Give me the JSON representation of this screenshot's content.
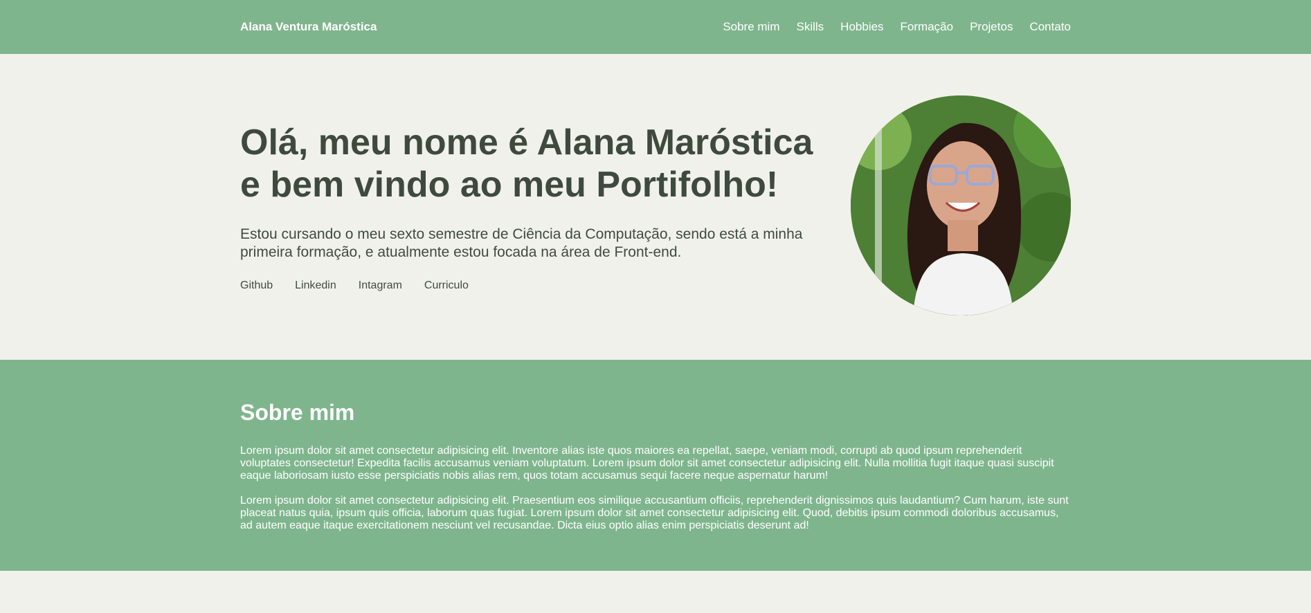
{
  "header": {
    "brand": "Alana Ventura Maróstica",
    "nav": [
      "Sobre mim",
      "Skills",
      "Hobbies",
      "Formação",
      "Projetos",
      "Contato"
    ]
  },
  "hero": {
    "title_line1": "Olá, meu nome é Alana Maróstica",
    "title_line2": "e bem vindo ao meu Portifolho!",
    "subtitle": "Estou cursando o meu sexto semestre de Ciência da Computação, sendo está a minha primeira formação, e atualmente estou focada na área de Front-end.",
    "links": [
      "Github",
      "Linkedin",
      "Intagram",
      "Curriculo"
    ]
  },
  "about": {
    "title": "Sobre mim",
    "paragraphs": [
      "Lorem ipsum dolor sit amet consectetur adipisicing elit. Inventore alias iste quos maiores ea repellat, saepe, veniam modi, corrupti ab quod ipsum reprehenderit voluptates consectetur! Expedita facilis accusamus veniam voluptatum. Lorem ipsum dolor sit amet consectetur adipisicing elit. Nulla mollitia fugit itaque quasi suscipit eaque laboriosam iusto esse perspiciatis nobis alias rem, quos totam accusamus sequi facere neque aspernatur harum!",
      "Lorem ipsum dolor sit amet consectetur adipisicing elit. Praesentium eos similique accusantium officiis, reprehenderit dignissimos quis laudantium? Cum harum, iste sunt placeat natus quia, ipsum quis officia, laborum quas fugiat. Lorem ipsum dolor sit amet consectetur adipisicing elit. Quod, debitis ipsum commodi doloribus accusamus, ad autem eaque itaque exercitationem nesciunt vel recusandae. Dicta eius optio alias enim perspiciatis deserunt ad!"
    ]
  },
  "colors": {
    "accent": "#7fb58d",
    "background": "#f1f1ec",
    "text": "#3f4a3f"
  }
}
